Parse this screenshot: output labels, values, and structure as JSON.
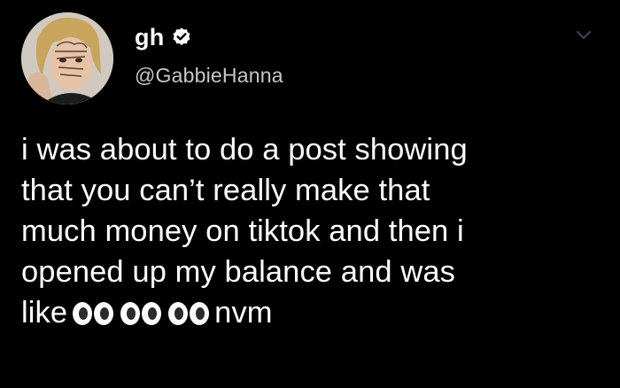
{
  "tweet": {
    "display_name": "gh",
    "handle": "@GabbieHanna",
    "lines": [
      "i was about to do a post showing",
      "that you can’t really make that",
      "much money on tiktok and then i",
      "opened up my balance and was"
    ],
    "last_line_start": "like",
    "last_line_end": "nvm",
    "emoji": [
      "eyes-emoji",
      "eyes-emoji",
      "eyes-emoji"
    ]
  },
  "colors": {
    "background": "#000000",
    "text": "#ffffff",
    "handle": "#c7c7c7",
    "verified": "#ffffff"
  },
  "icons": {
    "verified": "verified-badge-icon",
    "menu": "chevron-down-icon"
  }
}
